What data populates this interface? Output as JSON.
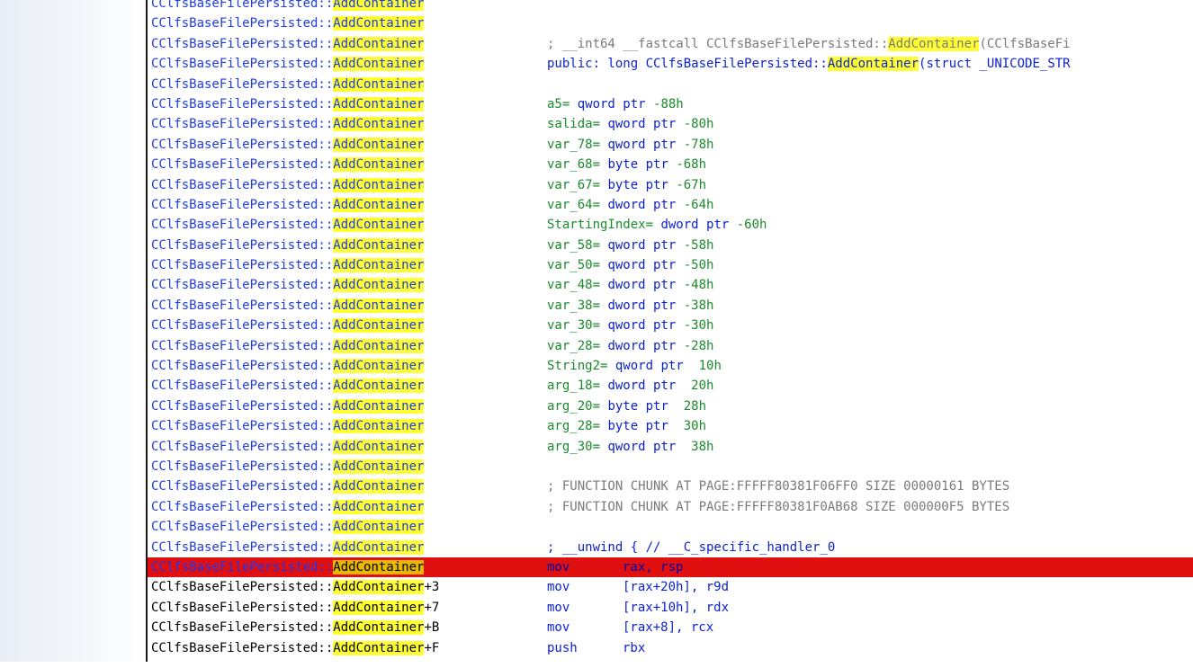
{
  "window": {
    "title": ""
  },
  "listing": {
    "class_prefix": "CClfsBaseFilePersisted::",
    "function_name": "AddContainer",
    "rows": [
      {
        "kind": "blank",
        "offset": "",
        "text": ""
      },
      {
        "kind": "blank",
        "offset": "",
        "text": ""
      },
      {
        "kind": "comment",
        "offset": "",
        "pre": "; __int64 __fastcall CClfsBaseFilePersisted::",
        "hl": "AddContainer",
        "post": "(CClfsBaseFi"
      },
      {
        "kind": "decl",
        "offset": "",
        "pre": "public: long CClfsBaseFilePersisted::",
        "hl": "AddContainer",
        "post": "(struct _UNICODE_STR"
      },
      {
        "kind": "blank",
        "offset": "",
        "text": ""
      },
      {
        "kind": "var",
        "offset": "",
        "name": "a5",
        "type": "qword ptr",
        "val": "-88h"
      },
      {
        "kind": "var",
        "offset": "",
        "name": "salida",
        "type": "qword ptr",
        "val": "-80h"
      },
      {
        "kind": "var",
        "offset": "",
        "name": "var_78",
        "type": "qword ptr",
        "val": "-78h"
      },
      {
        "kind": "var",
        "offset": "",
        "name": "var_68",
        "type": "byte ptr",
        "val": "-68h"
      },
      {
        "kind": "var",
        "offset": "",
        "name": "var_67",
        "type": "byte ptr",
        "val": "-67h"
      },
      {
        "kind": "var",
        "offset": "",
        "name": "var_64",
        "type": "dword ptr",
        "val": "-64h"
      },
      {
        "kind": "var",
        "offset": "",
        "name": "StartingIndex",
        "type": "dword ptr",
        "val": "-60h"
      },
      {
        "kind": "var",
        "offset": "",
        "name": "var_58",
        "type": "qword ptr",
        "val": "-58h"
      },
      {
        "kind": "var",
        "offset": "",
        "name": "var_50",
        "type": "qword ptr",
        "val": "-50h"
      },
      {
        "kind": "var",
        "offset": "",
        "name": "var_48",
        "type": "dword ptr",
        "val": "-48h"
      },
      {
        "kind": "var",
        "offset": "",
        "name": "var_38",
        "type": "dword ptr",
        "val": "-38h"
      },
      {
        "kind": "var",
        "offset": "",
        "name": "var_30",
        "type": "qword ptr",
        "val": "-30h"
      },
      {
        "kind": "var",
        "offset": "",
        "name": "var_28",
        "type": "dword ptr",
        "val": "-28h"
      },
      {
        "kind": "var",
        "offset": "",
        "name": "String2",
        "type": "qword ptr",
        "val": " 10h"
      },
      {
        "kind": "var",
        "offset": "",
        "name": "arg_18",
        "type": "dword ptr",
        "val": " 20h"
      },
      {
        "kind": "var",
        "offset": "",
        "name": "arg_20",
        "type": "byte ptr",
        "val": " 28h"
      },
      {
        "kind": "var",
        "offset": "",
        "name": "arg_28",
        "type": "byte ptr",
        "val": " 30h"
      },
      {
        "kind": "var",
        "offset": "",
        "name": "arg_30",
        "type": "qword ptr",
        "val": " 38h"
      },
      {
        "kind": "blank",
        "offset": "",
        "text": ""
      },
      {
        "kind": "chunk",
        "offset": "",
        "text": "; FUNCTION CHUNK AT PAGE:FFFFF80381F06FF0 SIZE 00000161 BYTES"
      },
      {
        "kind": "chunk",
        "offset": "",
        "text": "; FUNCTION CHUNK AT PAGE:FFFFF80381F0AB68 SIZE 000000F5 BYTES"
      },
      {
        "kind": "blank",
        "offset": "",
        "text": ""
      },
      {
        "kind": "unwind",
        "offset": "",
        "text": "; __unwind { // __C_specific_handler_0"
      },
      {
        "kind": "insn",
        "current": true,
        "offset": "",
        "mnemonic": "mov",
        "operands": "rax, rsp"
      },
      {
        "kind": "insn",
        "current": false,
        "offset": "+3",
        "mnemonic": "mov",
        "operands": "[rax+20h], r9d"
      },
      {
        "kind": "insn",
        "current": false,
        "offset": "+7",
        "mnemonic": "mov",
        "operands": "[rax+10h], rdx"
      },
      {
        "kind": "insn",
        "current": false,
        "offset": "+B",
        "mnemonic": "mov",
        "operands": "[rax+8], rcx"
      },
      {
        "kind": "insn",
        "current": false,
        "offset": "+F",
        "mnemonic": "push",
        "operands": "rbx"
      }
    ]
  },
  "colors": {
    "highlight": "#ffff33",
    "current_line": "#e01010",
    "label_blue": "#1f3ce0",
    "var_green": "#1a8a2a",
    "comment_gray": "#7a7a7a"
  }
}
